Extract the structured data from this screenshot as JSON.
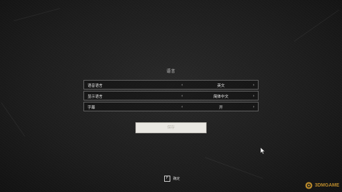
{
  "screen": {
    "title": "语言"
  },
  "options": [
    {
      "label": "语音语言",
      "value": "英文"
    },
    {
      "label": "显示语言",
      "value": "简体中文"
    },
    {
      "label": "字幕",
      "value": "开"
    }
  ],
  "arrows": {
    "left": "‹",
    "right": "›"
  },
  "confirm_button": {
    "label": "保存"
  },
  "hint": {
    "key": "F",
    "label": "确定"
  },
  "watermark": {
    "text": "3DMGAME",
    "logo_icon": "3dm-logo-icon"
  },
  "colors": {
    "background": "#1c1c1c",
    "button_fill": "#e9e7e2",
    "watermark": "#f2b233"
  }
}
